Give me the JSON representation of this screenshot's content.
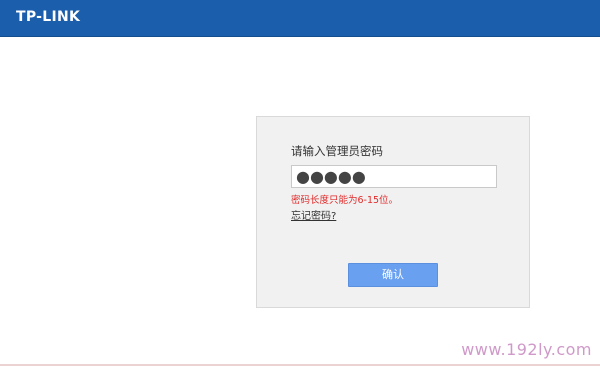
{
  "header": {
    "logo_text": "TP-LINK"
  },
  "login": {
    "prompt": "请输入管理员密码",
    "password_value": "●●●●●",
    "error_message": "密码长度只能为6-15位。",
    "forgot_link": "忘记密码?",
    "confirm_button": "确认"
  },
  "watermark": {
    "text": "www.192ly.com"
  },
  "colors": {
    "header_bg": "#1b5eab",
    "button_bg": "#6aa0f0",
    "error_text": "#e02b2b",
    "watermark_text": "#cf9ac9"
  }
}
